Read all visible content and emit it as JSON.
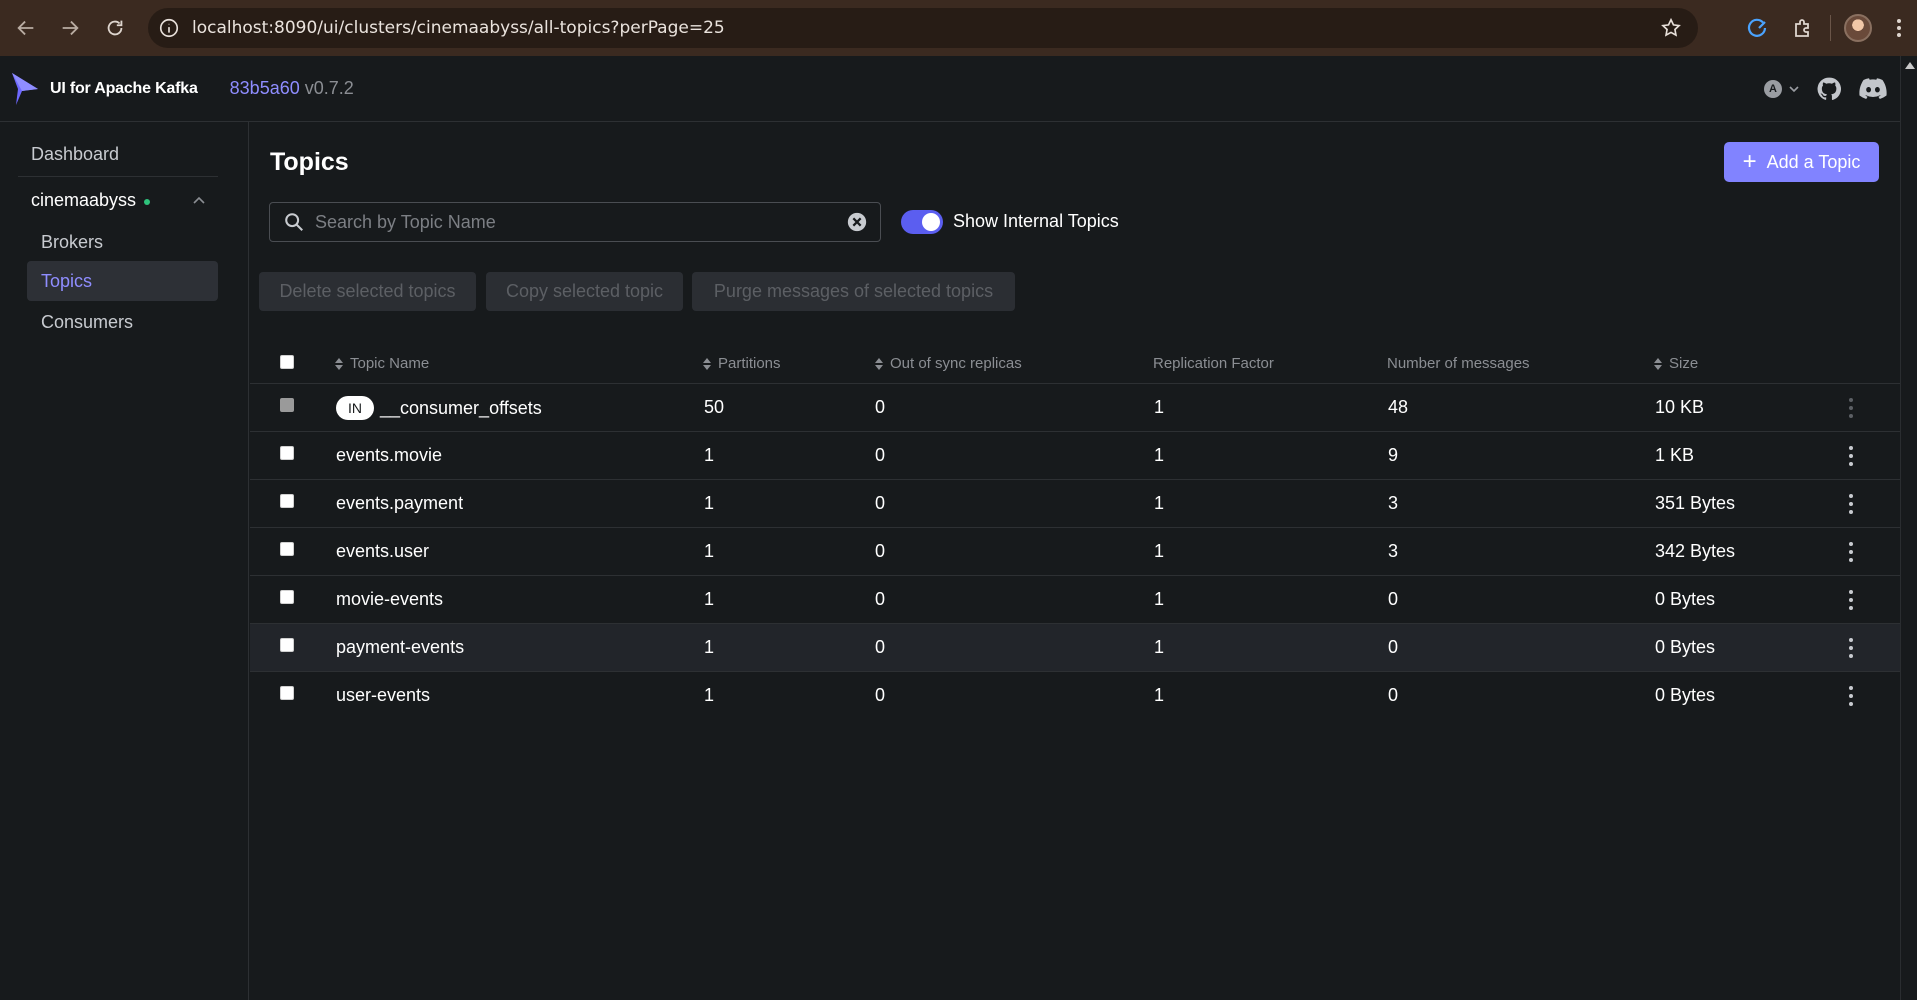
{
  "browser": {
    "url": "localhost:8090/ui/clusters/cinemaabyss/all-topics?perPage=25"
  },
  "header": {
    "app_title": "UI for Apache Kafka",
    "version_hash": "83b5a60",
    "version": "v0.7.2",
    "lang": "A"
  },
  "sidebar": {
    "dashboard": "Dashboard",
    "cluster": "cinemaabyss",
    "items": [
      {
        "label": "Brokers"
      },
      {
        "label": "Topics"
      },
      {
        "label": "Consumers"
      }
    ],
    "active_item": "Topics"
  },
  "page": {
    "title": "Topics",
    "add_button": "Add a Topic",
    "search_placeholder": "Search by Topic Name",
    "toggle_label": "Show Internal Topics",
    "show_internal": true,
    "bulk_actions": [
      "Delete selected topics",
      "Copy selected topic",
      "Purge messages of selected topics"
    ]
  },
  "table": {
    "columns": [
      "Topic Name",
      "Partitions",
      "Out of sync replicas",
      "Replication Factor",
      "Number of messages",
      "Size"
    ],
    "rows": [
      {
        "badge": "IN",
        "name": "__consumer_offsets",
        "partitions": "50",
        "out_of_sync": "0",
        "replication": "1",
        "messages": "48",
        "size": "10 KB"
      },
      {
        "badge": "",
        "name": "events.movie",
        "partitions": "1",
        "out_of_sync": "0",
        "replication": "1",
        "messages": "9",
        "size": "1 KB"
      },
      {
        "badge": "",
        "name": "events.payment",
        "partitions": "1",
        "out_of_sync": "0",
        "replication": "1",
        "messages": "3",
        "size": "351 Bytes"
      },
      {
        "badge": "",
        "name": "events.user",
        "partitions": "1",
        "out_of_sync": "0",
        "replication": "1",
        "messages": "3",
        "size": "342 Bytes"
      },
      {
        "badge": "",
        "name": "movie-events",
        "partitions": "1",
        "out_of_sync": "0",
        "replication": "1",
        "messages": "0",
        "size": "0 Bytes"
      },
      {
        "badge": "",
        "name": "payment-events",
        "partitions": "1",
        "out_of_sync": "0",
        "replication": "1",
        "messages": "0",
        "size": "0 Bytes"
      },
      {
        "badge": "",
        "name": "user-events",
        "partitions": "1",
        "out_of_sync": "0",
        "replication": "1",
        "messages": "0",
        "size": "0 Bytes"
      }
    ]
  }
}
